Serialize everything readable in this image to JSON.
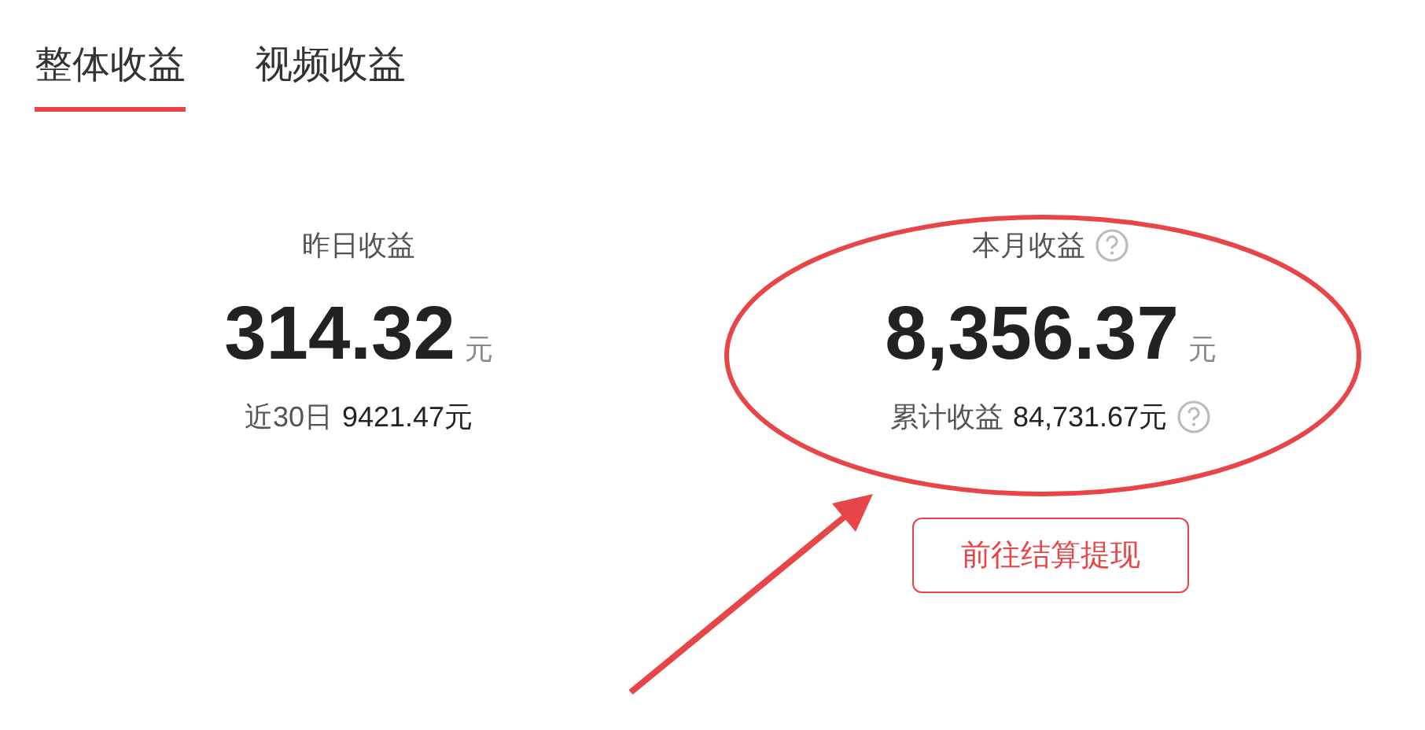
{
  "tabs": [
    {
      "label": "整体收益",
      "selected": true
    },
    {
      "label": "视频收益",
      "selected": false
    }
  ],
  "cards": [
    {
      "label": "昨日收益",
      "label_help": false,
      "amount": "314.32",
      "unit": "元",
      "sub_label": "近30日",
      "sub_value": "9421.47元",
      "sub_help": false
    },
    {
      "label": "本月收益",
      "label_help": true,
      "amount": "8,356.37",
      "unit": "元",
      "sub_label": "累计收益",
      "sub_value": "84,731.67元",
      "sub_help": true,
      "button": "前往结算提现"
    }
  ],
  "annotation": {
    "ellipse": true,
    "arrow": true
  }
}
